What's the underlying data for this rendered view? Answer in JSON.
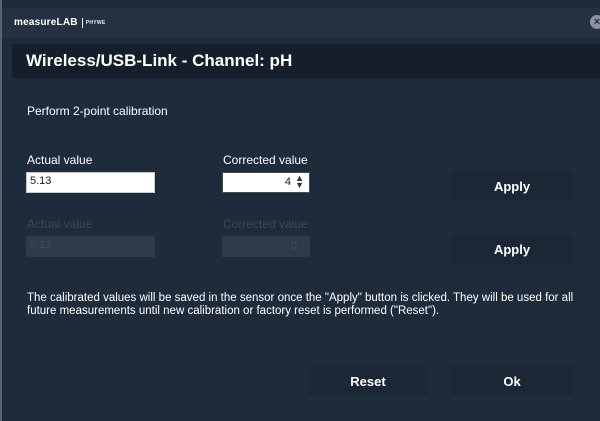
{
  "window": {
    "brand": "measureLAB",
    "brand_sub": "PHYWE",
    "close_symbol": "×"
  },
  "header": {
    "title": "Wireless/USB-Link - Channel: pH"
  },
  "calibration": {
    "subtitle": "Perform 2-point calibration",
    "point1": {
      "actual_label": "Actual value",
      "actual_value": "5.13",
      "corrected_label": "Corrected value",
      "corrected_value": "4",
      "apply_label": "Apply"
    },
    "point2": {
      "actual_label": "Actual value",
      "actual_value": "5.13",
      "corrected_label": "Corrected value",
      "corrected_value": "0",
      "apply_label": "Apply"
    },
    "note": "The calibrated values will be saved in the sensor once the \"Apply\" button is clicked. They will be used for all future measurements until new calibration or factory reset is performed (\"Reset\")."
  },
  "footer": {
    "reset_label": "Reset",
    "ok_label": "Ok"
  },
  "colors": {
    "dialog_bg": "#1e2b3a",
    "header_bg": "#151f2b",
    "button_bg": "#1b2735",
    "disabled_text": "#3a4758"
  }
}
